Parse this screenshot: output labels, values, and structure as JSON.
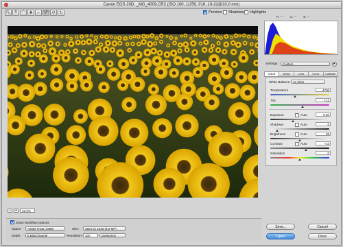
{
  "window": {
    "title": "Canon EOS 20D: _MG_4009.CR2  (ISO 100, 1/250, f/16, 10-22@10.0 mm)"
  },
  "toolbar": {
    "tools": [
      "zoom-icon",
      "hand-icon",
      "white-balance-icon",
      "color-sampler-icon",
      "crop-icon",
      "straighten-icon",
      "rotate-left-icon",
      "rotate-right-icon"
    ],
    "active_tool": "straighten-icon",
    "preview_label": "Preview",
    "shadows_label": "Shadows",
    "highlights_label": "Highlights",
    "preview_checked": true,
    "shadows_checked": false,
    "highlights_checked": false
  },
  "histogram": {
    "r_label": "R: ---",
    "g_label": "G: ---",
    "b_label": "B: ---"
  },
  "settings": {
    "label": "Settings:",
    "value": "Custom"
  },
  "tabs": [
    "Adjust",
    "Detail",
    "Lens",
    "Curve",
    "Calibrate"
  ],
  "adjust": {
    "white_balance_label": "White Balance:",
    "white_balance_value": "As Shot",
    "temperature_label": "Temperature",
    "temperature_value": "4700",
    "tint_label": "Tint",
    "tint_value": "+12",
    "exposure_label": "Exposure",
    "exposure_value": "-0.80",
    "shadows_label": "Shadows",
    "shadows_value": "6",
    "brightness_label": "Brightness",
    "brightness_value": "98",
    "contrast_label": "Contrast",
    "contrast_value": "+23",
    "saturation_label": "Saturation",
    "saturation_value": "0",
    "auto_label": "Auto",
    "slider_positions": {
      "temperature": 0.42,
      "tint": 0.55,
      "exposure": 0.38,
      "shadows": 0.12,
      "brightness": 0.5,
      "contrast": 0.6,
      "saturation": 0.5
    }
  },
  "zoom": {
    "value": "22.2%"
  },
  "workflow": {
    "show_label": "Show Workflow Options",
    "show_checked": true,
    "space_label": "Space:",
    "space_value": "Adobe RGB (1998)",
    "size_label": "Size:",
    "size_value": "3504 by 2336  (8.2 MP)",
    "depth_label": "Depth:",
    "depth_value": "8 Bits/Channel",
    "resolution_label": "Resolution:",
    "resolution_value": "300",
    "resolution_unit": "pixels/inch"
  },
  "buttons": {
    "save": "Save...",
    "open": "Open",
    "cancel": "Cancel",
    "done": "Done"
  }
}
